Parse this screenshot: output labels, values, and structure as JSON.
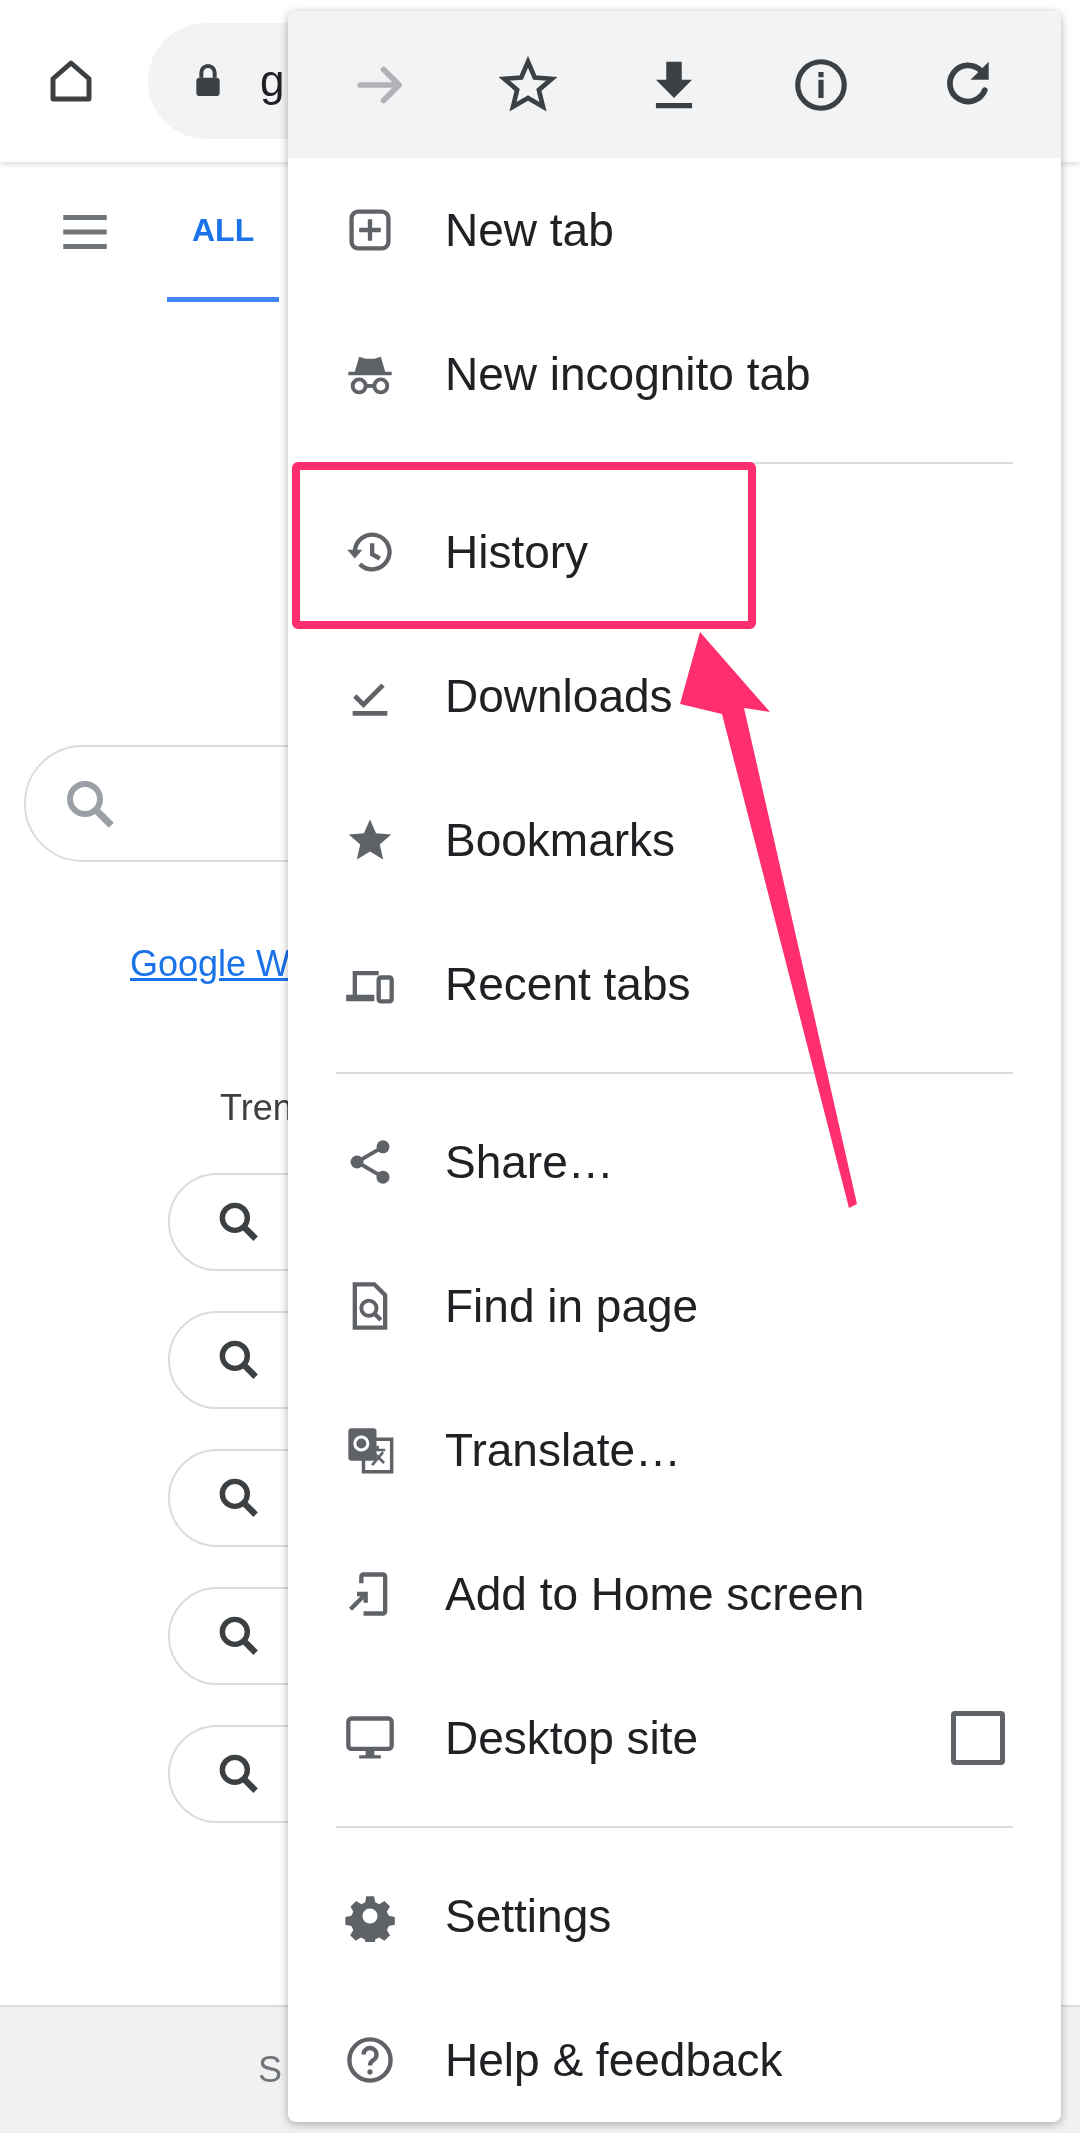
{
  "browser_bar": {
    "url": "g"
  },
  "page": {
    "tabs": [
      {
        "label": "ALL",
        "selected": true
      }
    ],
    "link": "Google W",
    "trending_label": "Tren",
    "footer_text": "S"
  },
  "menu": {
    "top_icons": [
      {
        "kind": "forward",
        "disabled": true
      },
      {
        "kind": "bookmark",
        "disabled": false
      },
      {
        "kind": "download",
        "disabled": false
      },
      {
        "kind": "info",
        "disabled": false
      },
      {
        "kind": "reload",
        "disabled": false
      }
    ],
    "sections": [
      [
        {
          "kind": "new_tab",
          "label": "New tab",
          "highlighted": false
        },
        {
          "kind": "incognito",
          "label": "New incognito tab",
          "highlighted": false
        }
      ],
      [
        {
          "kind": "history",
          "label": "History",
          "highlighted": true
        },
        {
          "kind": "downloads",
          "label": "Downloads",
          "highlighted": false
        },
        {
          "kind": "bookmarks",
          "label": "Bookmarks",
          "highlighted": false
        },
        {
          "kind": "recent_tabs",
          "label": "Recent tabs",
          "highlighted": false
        }
      ],
      [
        {
          "kind": "share",
          "label": "Share…",
          "highlighted": false
        },
        {
          "kind": "find",
          "label": "Find in page",
          "highlighted": false
        },
        {
          "kind": "translate",
          "label": "Translate…",
          "highlighted": false
        },
        {
          "kind": "add_home",
          "label": "Add to Home screen",
          "highlighted": false
        },
        {
          "kind": "desktop",
          "label": "Desktop site",
          "highlighted": false,
          "checked": false
        }
      ],
      [
        {
          "kind": "settings",
          "label": "Settings",
          "highlighted": false
        },
        {
          "kind": "help",
          "label": "Help & feedback",
          "highlighted": false
        }
      ]
    ]
  }
}
